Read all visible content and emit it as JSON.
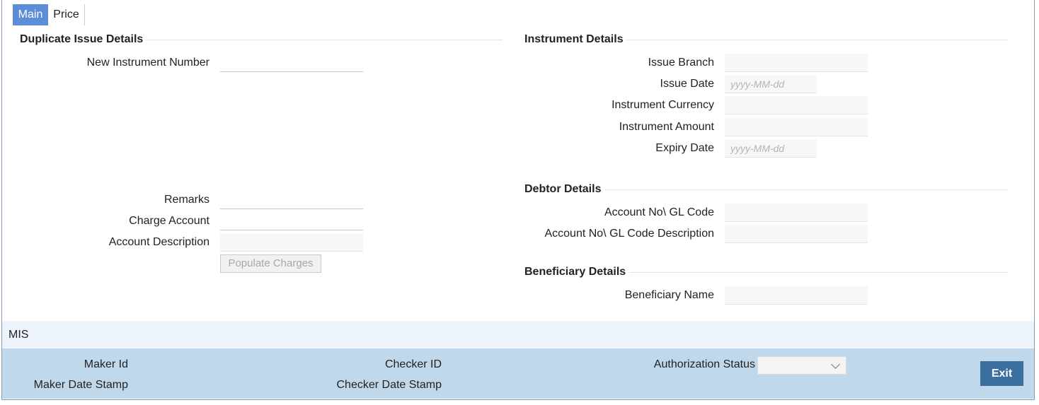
{
  "tabs": [
    {
      "label": "Main"
    },
    {
      "label": "Price"
    }
  ],
  "duplicate_issue": {
    "title": "Duplicate Issue Details",
    "new_instrument_number_label": "New Instrument Number",
    "remarks_label": "Remarks",
    "charge_account_label": "Charge Account",
    "account_description_label": "Account Description",
    "populate_charges_label": "Populate Charges"
  },
  "instrument": {
    "title": "Instrument Details",
    "issue_branch_label": "Issue Branch",
    "issue_date_label": "Issue Date",
    "issue_date_placeholder": "yyyy-MM-dd",
    "currency_label": "Instrument Currency",
    "amount_label": "Instrument Amount",
    "expiry_date_label": "Expiry Date",
    "expiry_date_placeholder": "yyyy-MM-dd"
  },
  "debtor": {
    "title": "Debtor Details",
    "account_gl_label": "Account No\\ GL Code",
    "account_gl_desc_label": "Account No\\ GL Code Description"
  },
  "beneficiary": {
    "title": "Beneficiary Details",
    "name_label": "Beneficiary Name"
  },
  "mis": {
    "label": "MIS"
  },
  "footer": {
    "maker_id_label": "Maker Id",
    "maker_date_label": "Maker Date Stamp",
    "checker_id_label": "Checker ID",
    "checker_date_label": "Checker Date Stamp",
    "auth_status_label": "Authorization Status",
    "auth_status_value": "",
    "exit_label": "Exit"
  },
  "colors": {
    "active_tab": "#5b8ed6",
    "footer_bg": "#c0d8ec",
    "mis_bg": "#eef4fb",
    "exit_button": "#3a6f9f"
  }
}
